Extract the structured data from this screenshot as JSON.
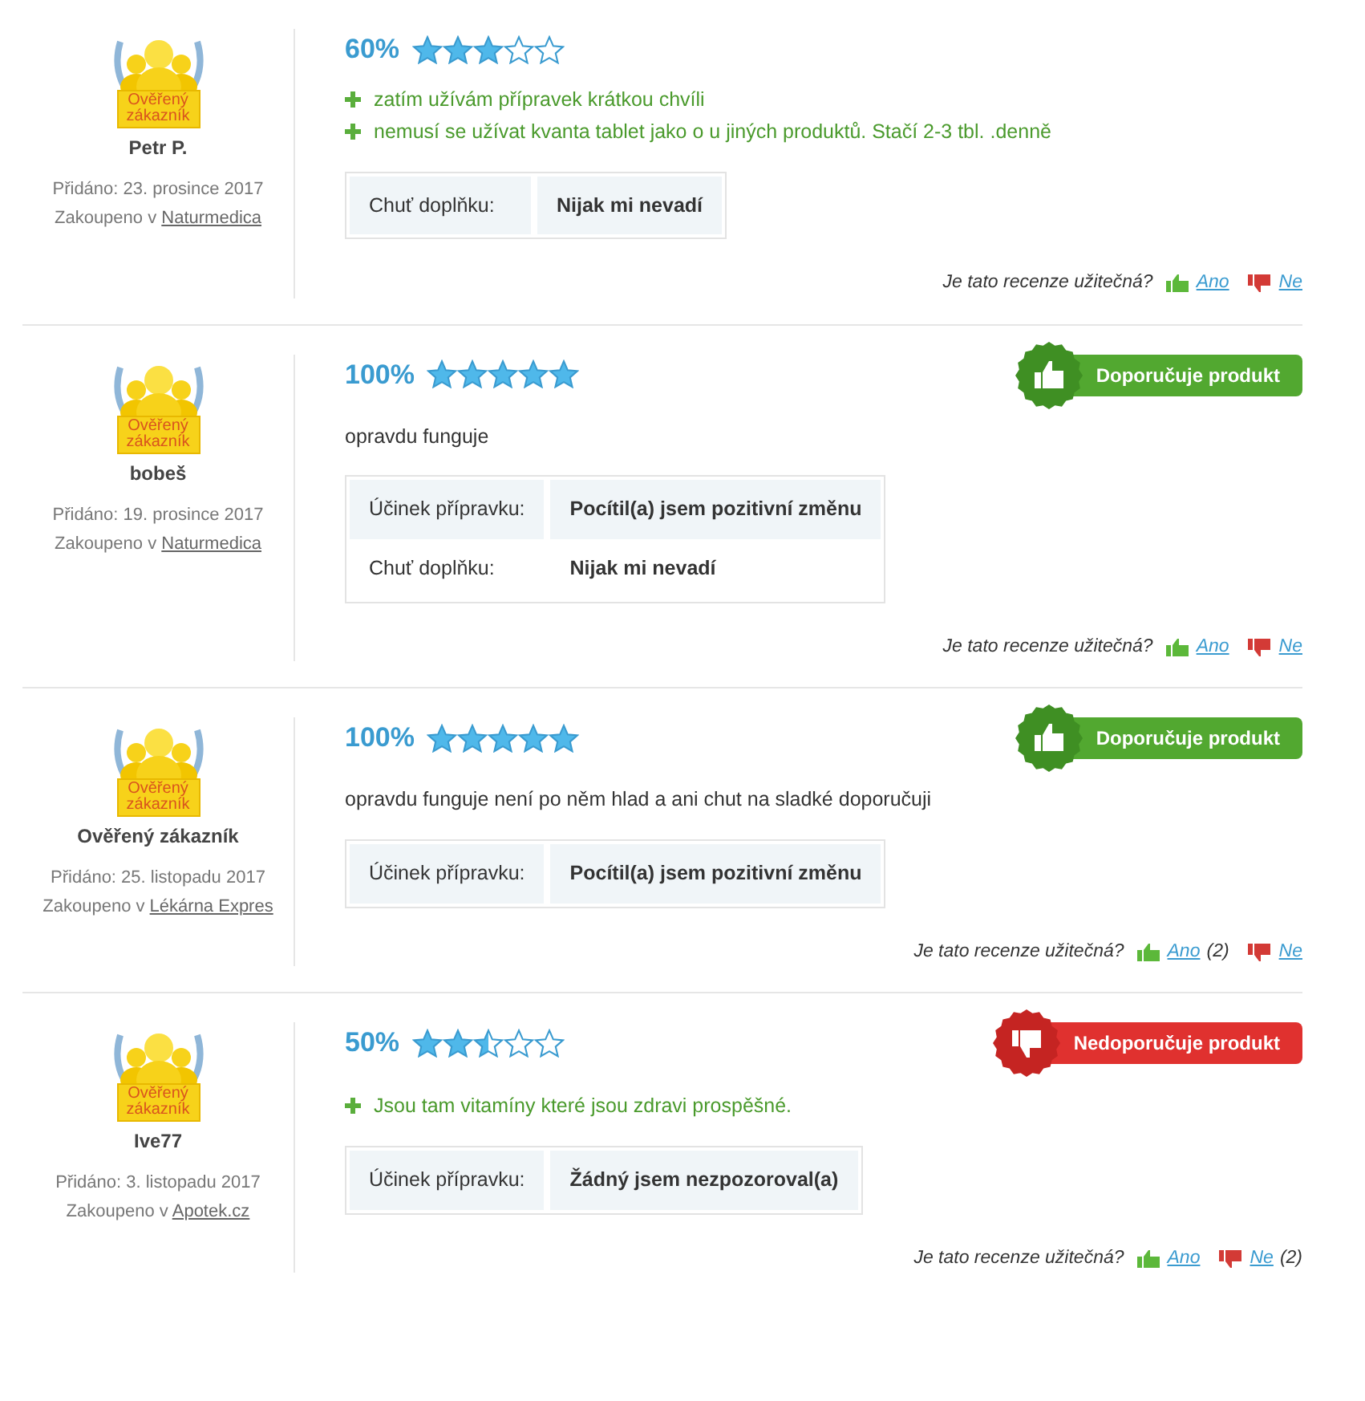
{
  "reviews": [
    {
      "badge": "Ověřený zákazník",
      "name": "Petr P.",
      "added": "Přidáno: 23. prosince 2017",
      "bought": "Zakoupeno v",
      "shop": "Naturmedica",
      "percent": "60%",
      "stars": 3,
      "pros": [
        "zatím užívám přípravek krátkou chvíli",
        "nemusí se užívat kvanta tablet jako o u jiných produktů. Stačí 2-3 tbl. .denně"
      ],
      "params": [
        {
          "label": "Chuť doplňku:",
          "value": "Nijak mi nevadí"
        }
      ],
      "helpful": {
        "question": "Je tato recenze užitečná?",
        "yes": "Ano",
        "no": "Ne"
      }
    },
    {
      "badge": "Ověřený zákazník",
      "name": "bobeš",
      "added": "Přidáno: 19. prosince 2017",
      "bought": "Zakoupeno v",
      "shop": "Naturmedica",
      "percent": "100%",
      "stars": 5,
      "recommendation": {
        "kind": "positive",
        "label": "Doporučuje produkt"
      },
      "text": "opravdu funguje",
      "params": [
        {
          "label": "Účinek přípravku:",
          "value": "Pocítil(a) jsem pozitivní změnu"
        },
        {
          "label": "Chuť doplňku:",
          "value": "Nijak mi nevadí"
        }
      ],
      "helpful": {
        "question": "Je tato recenze užitečná?",
        "yes": "Ano",
        "no": "Ne"
      }
    },
    {
      "badge": "Ověřený zákazník",
      "name": "Ověřený zákazník",
      "added": "Přidáno: 25. listopadu 2017",
      "bought": "Zakoupeno v",
      "shop": "Lékárna Expres",
      "percent": "100%",
      "stars": 5,
      "recommendation": {
        "kind": "positive",
        "label": "Doporučuje produkt"
      },
      "text": "opravdu funguje není po něm hlad a ani chut na sladké doporučuji",
      "params": [
        {
          "label": "Účinek přípravku:",
          "value": "Pocítil(a) jsem pozitivní změnu"
        }
      ],
      "helpful": {
        "question": "Je tato recenze užitečná?",
        "yes": "Ano",
        "yes_count": "(2)",
        "no": "Ne"
      }
    },
    {
      "badge": "Ověřený zákazník",
      "name": "Ive77",
      "added": "Přidáno: 3. listopadu 2017",
      "bought": "Zakoupeno v",
      "shop": "Apotek.cz",
      "percent": "50%",
      "stars": 2.5,
      "recommendation": {
        "kind": "negative",
        "label": "Nedoporučuje produkt"
      },
      "pros": [
        "Jsou tam vitamíny které jsou zdravi prospěšné."
      ],
      "params": [
        {
          "label": "Účinek přípravku:",
          "value": "Žádný jsem nezpozoroval(a)"
        }
      ],
      "helpful": {
        "question": "Je tato recenze užitečná?",
        "yes": "Ano",
        "no": "Ne",
        "no_count": "(2)"
      }
    }
  ]
}
